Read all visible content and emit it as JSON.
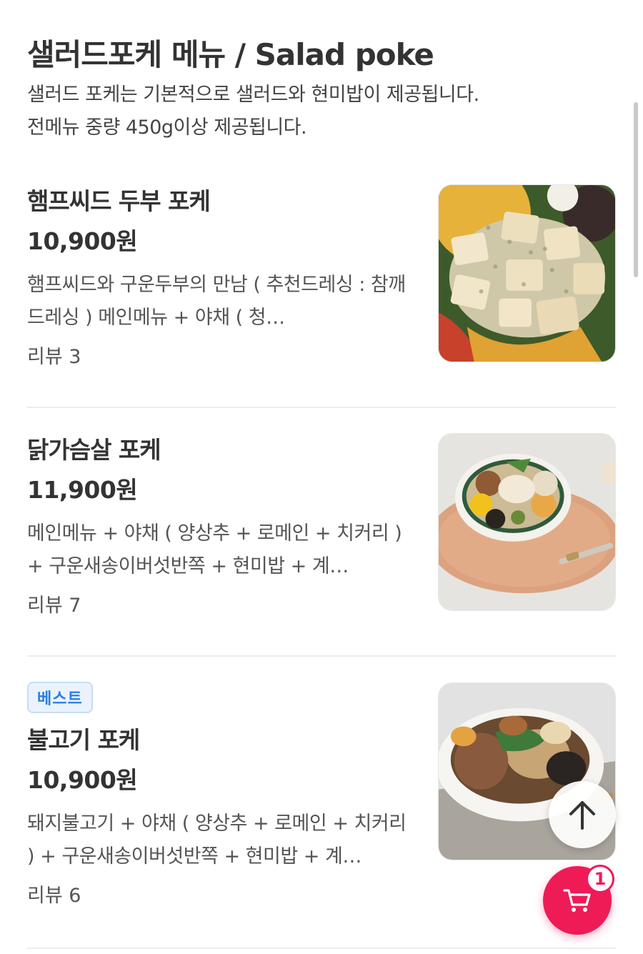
{
  "section": {
    "title": "샐러드포케 메뉴  /  Salad poke",
    "desc_line1": "샐러드 포케는 기본적으로 샐러드와 현미밥이 제공됩니다.",
    "desc_line2": "전메뉴 중량 450g이상 제공됩니다."
  },
  "menu_items": [
    {
      "name": "햄프씨드 두부 포케",
      "price": "10,900원",
      "desc": "햄프씨드와 구운두부의 만남 ( 추천드레싱 : 참깨드레싱 ) 메인메뉴 + 야채 ( 청…",
      "review": "리뷰 3",
      "badge": ""
    },
    {
      "name": "닭가슴살 포케",
      "price": "11,900원",
      "desc": "메인메뉴 + 야채 ( 양상추 + 로메인 + 치커리 ) + 구운새송이버섯반쪽 + 현미밥 + 계…",
      "review": "리뷰 7",
      "badge": ""
    },
    {
      "name": "불고기 포케",
      "price": "10,900원",
      "desc": "돼지불고기 + 야채 ( 양상추 + 로메인 + 치커리 ) + 구운새송이버섯반쪽 + 현미밥 + 계…",
      "review": "리뷰 6",
      "badge": "베스트"
    }
  ],
  "cart": {
    "count": "1",
    "icon": "cart-icon"
  },
  "scroll_top": {
    "icon": "arrow-up-icon"
  },
  "colors": {
    "accent": "#ee1b57",
    "badge_text": "#2a7de1",
    "badge_bg": "#eaf3fd"
  }
}
